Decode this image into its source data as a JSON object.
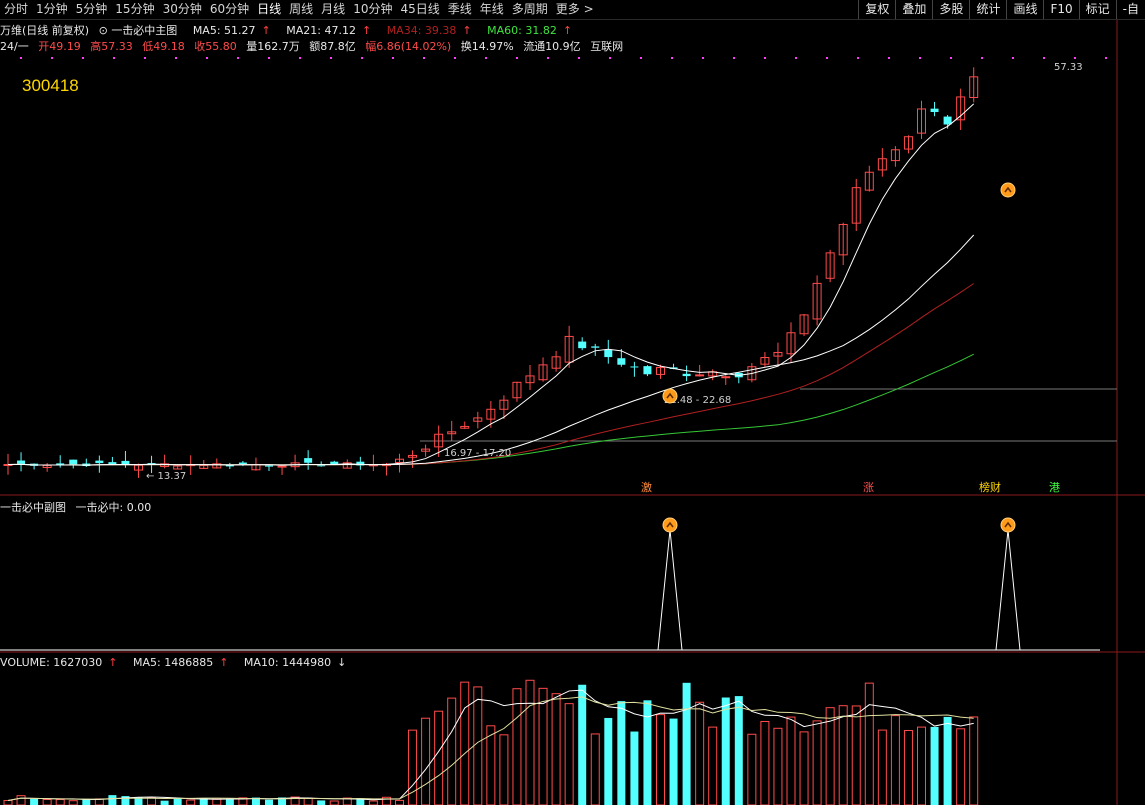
{
  "toolbar": {
    "periods": [
      "分时",
      "1分钟",
      "5分钟",
      "15分钟",
      "30分钟",
      "60分钟",
      "日线",
      "周线",
      "月线",
      "10分钟",
      "45日线",
      "季线",
      "年线",
      "多周期",
      "更多 >"
    ],
    "active_period": "日线",
    "tools": [
      "复权",
      "叠加",
      "多股",
      "统计",
      "画线",
      "F10",
      "标记",
      "-自"
    ]
  },
  "main_title": {
    "name": "万维(日线 前复权)",
    "indicator": "一击必中主图",
    "ma5": "MA5: 51.27",
    "ma21": "MA21: 47.12",
    "ma34": "MA34: 39.38",
    "ma60": "MA60: 31.82"
  },
  "quote": {
    "date": "24/一",
    "open": "开49.19",
    "high": "高57.33",
    "low": "低49.18",
    "close": "收55.80",
    "volume": "量162.7万",
    "amount": "额87.8亿",
    "change": "幅6.86(14.02%)",
    "turnover": "换14.97%",
    "float": "流通10.9亿",
    "sector": "互联网"
  },
  "stock_code": "300418",
  "price_labels": {
    "high_label": "57.33",
    "low_label": "13.37",
    "range1": "16.97 - 17.20",
    "range2": "22.48 - 22.68"
  },
  "tags": [
    {
      "text": "激",
      "color": "#ff8a3c"
    },
    {
      "text": "涨",
      "color": "#ff5050"
    },
    {
      "text": "榜财",
      "color": "#ffd700"
    },
    {
      "text": "港",
      "color": "#40ff40"
    }
  ],
  "sub1": {
    "title": "一击必中副图",
    "value": "一击必中: 0.00"
  },
  "volume": {
    "title": "VOLUME: 1627030",
    "ma5": "MA5: 1486885",
    "ma10": "MA10: 1444980"
  },
  "colors": {
    "up": "#ff4b4b",
    "down": "#54ffff",
    "ma5": "#ffffff",
    "ma21": "#ffffff",
    "ma34": "#b02020",
    "ma60": "#35c835"
  }
}
